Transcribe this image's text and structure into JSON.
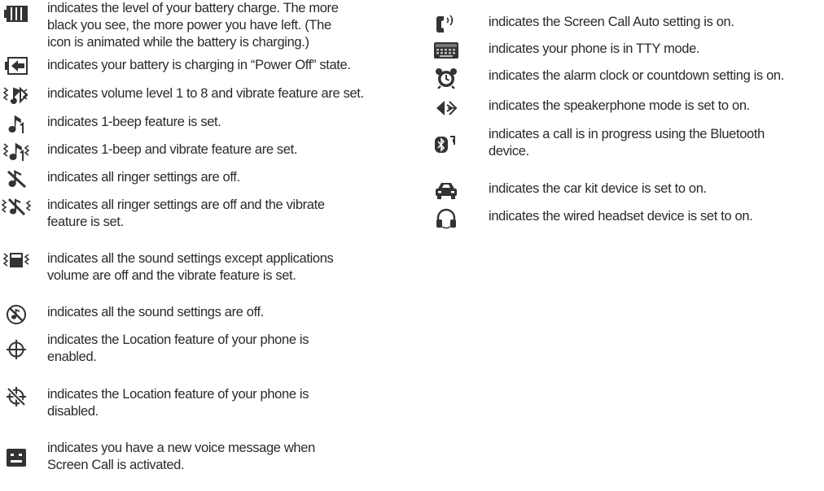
{
  "left_items": [
    {
      "icon": "battery-level-icon",
      "text": "indicates the level of your battery charge. The more\nblack you see, the more power you have left. (The\nicon is animated while the battery is charging.)"
    },
    {
      "icon": "battery-charging-power-off-icon",
      "text": "indicates your battery is charging in “Power Off” state."
    },
    {
      "icon": "volume-vibrate-icon",
      "text": "indicates volume level 1 to 8 and vibrate feature  are set."
    },
    {
      "icon": "one-beep-icon",
      "text": "indicates 1-beep feature is set."
    },
    {
      "icon": "one-beep-vibrate-icon",
      "text": "indicates 1-beep and vibrate feature are set."
    },
    {
      "icon": "ringer-off-icon",
      "text": "indicates all ringer settings are off."
    },
    {
      "icon": "ringer-off-vibrate-icon",
      "text": "indicates all ringer settings are off and the vibrate\nfeature is set."
    },
    {
      "icon": "sound-off-vibrate-icon",
      "text": "indicates all the sound settings except applications\nvolume are off and the vibrate feature is set."
    },
    {
      "icon": "all-sound-off-icon",
      "text": "indicates all the sound settings are off."
    },
    {
      "icon": "location-on-icon",
      "text": "indicates the Location feature of your phone is\nenabled."
    },
    {
      "icon": "location-off-icon",
      "text": "indicates the Location feature of your phone is\ndisabled."
    },
    {
      "icon": "voice-message-icon",
      "text": "indicates you have a new voice message when\nScreen Call is activated."
    }
  ],
  "right_items": [
    {
      "icon": "screen-call-auto-icon",
      "text": "indicates the Screen Call Auto setting is on."
    },
    {
      "icon": "tty-mode-icon",
      "text": "indicates your phone is in TTY mode."
    },
    {
      "icon": "alarm-clock-icon",
      "text": "indicates the alarm clock or countdown setting is on."
    },
    {
      "icon": "speakerphone-icon",
      "text": "indicates the speakerphone mode is set to on."
    },
    {
      "icon": "bluetooth-call-icon",
      "text": "indicates a call is in progress using the Bluetooth\ndevice."
    },
    {
      "icon": "car-kit-icon",
      "text": "indicates the car kit device is set to on."
    },
    {
      "icon": "wired-headset-icon",
      "text": "indicates the wired headset device is set to on."
    }
  ]
}
